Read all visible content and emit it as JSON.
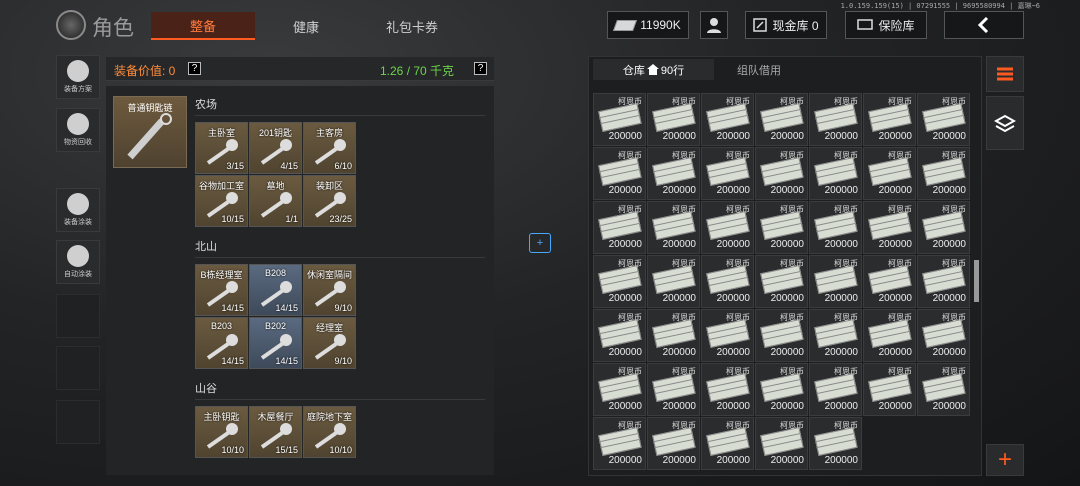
{
  "version": "1.0.159.159(15) | 07291555 | 9695580994 | 嘉琳~6",
  "header": {
    "title": "角色",
    "tabs": [
      "整备",
      "健康",
      "礼包卡券"
    ],
    "active_tab": 0,
    "money": "11990K",
    "cash_vault": "现金库 0",
    "safe": "保险库"
  },
  "sidebar": [
    {
      "label": "装备方案",
      "icon": "gear-plan-icon"
    },
    {
      "label": "物资回收",
      "icon": "recycle-icon"
    },
    {
      "label": "装备涂装",
      "icon": "paint-icon"
    },
    {
      "label": "自动涂装",
      "icon": "auto-paint-icon"
    }
  ],
  "equip": {
    "value_label": "装备价值: 0",
    "weight": "1.26 / 70 千克",
    "main_item": "普通钥匙链"
  },
  "key_sections": [
    {
      "name": "农场",
      "keys": [
        {
          "n": "主卧室",
          "c": "3/15",
          "blue": false
        },
        {
          "n": "201钥匙",
          "c": "4/15",
          "blue": false
        },
        {
          "n": "主客房",
          "c": "6/10",
          "blue": false
        },
        {
          "n": "谷物加工室",
          "c": "10/15",
          "blue": false
        },
        {
          "n": "墓地",
          "c": "1/1",
          "blue": false
        },
        {
          "n": "装卸区",
          "c": "23/25",
          "blue": false
        }
      ]
    },
    {
      "name": "北山",
      "keys": [
        {
          "n": "B栋经理室",
          "c": "14/15",
          "blue": false
        },
        {
          "n": "B208",
          "c": "14/15",
          "blue": true
        },
        {
          "n": "休闲室隔间",
          "c": "9/10",
          "blue": false
        },
        {
          "n": "B203",
          "c": "14/15",
          "blue": false
        },
        {
          "n": "B202",
          "c": "14/15",
          "blue": true
        },
        {
          "n": "经理室",
          "c": "9/10",
          "blue": false
        }
      ]
    },
    {
      "name": "山谷",
      "keys": [
        {
          "n": "主卧钥匙",
          "c": "10/10",
          "blue": false
        },
        {
          "n": "木屋餐厅",
          "c": "15/15",
          "blue": false
        },
        {
          "n": "庭院地下室",
          "c": "10/10",
          "blue": false
        }
      ]
    }
  ],
  "warehouse": {
    "tab1": "仓库",
    "rows": "90行",
    "tab2": "组队借用",
    "item_name": "柯恩币",
    "item_count": "200000",
    "count": 47
  },
  "colors": {
    "accent": "#ff5a1f",
    "weight": "#6cd44a",
    "value": "#ff8c3a"
  }
}
